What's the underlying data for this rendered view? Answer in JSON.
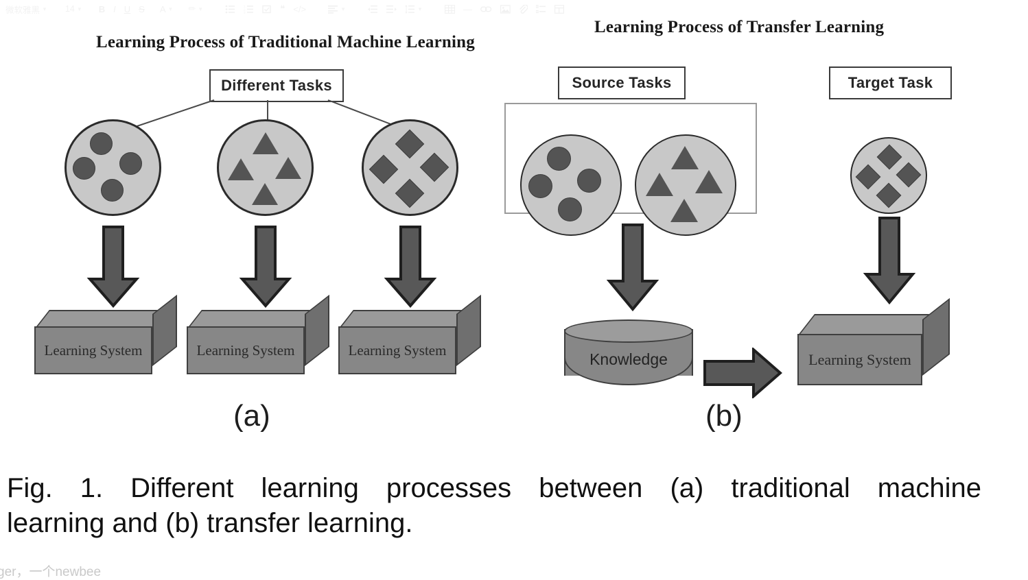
{
  "toolbar": {
    "font_family": "微软雅黑",
    "font_size": "14",
    "items": [
      {
        "name": "font-family-select",
        "label": "微软雅黑"
      },
      {
        "name": "font-size-select",
        "label": "14"
      },
      {
        "name": "bold-button",
        "label": "B"
      },
      {
        "name": "italic-button",
        "label": "I"
      },
      {
        "name": "underline-button",
        "label": "U"
      },
      {
        "name": "strikethrough-button",
        "label": "S"
      },
      {
        "name": "font-color-button",
        "label": "A"
      },
      {
        "name": "highlight-color-button",
        "label": "✏"
      },
      {
        "name": "bulleted-list-button",
        "label": "≔"
      },
      {
        "name": "numbered-list-button",
        "label": "≡"
      },
      {
        "name": "checklist-button",
        "label": "☑"
      },
      {
        "name": "blockquote-button",
        "label": "❝"
      },
      {
        "name": "code-block-button",
        "label": "</>"
      },
      {
        "name": "align-button",
        "label": "≣"
      },
      {
        "name": "outdent-button",
        "label": "⇤"
      },
      {
        "name": "indent-button",
        "label": "⇥"
      },
      {
        "name": "line-height-button",
        "label": "↕"
      },
      {
        "name": "table-button",
        "label": "▦"
      },
      {
        "name": "horizontal-rule-button",
        "label": "—"
      },
      {
        "name": "link-button",
        "label": "🔗"
      },
      {
        "name": "image-button",
        "label": "🖼"
      },
      {
        "name": "attachment-button",
        "label": "📎"
      },
      {
        "name": "task-list-button",
        "label": "☰"
      },
      {
        "name": "layout-button",
        "label": "▤"
      }
    ]
  },
  "figure": {
    "caption_line1": "Fig. 1. Different learning processes between (a) traditional machine",
    "caption_line2": "learning and (b) transfer learning.",
    "watermark": "ger，一个newbee",
    "panel_a": {
      "id": "(a)",
      "title": "Learning Process of Traditional Machine Learning",
      "source_box_label": "Different Tasks",
      "tasks": [
        {
          "shape": "circle",
          "count": 4,
          "system_label": "Learning System"
        },
        {
          "shape": "triangle",
          "count": 4,
          "system_label": "Learning System"
        },
        {
          "shape": "diamond",
          "count": 4,
          "system_label": "Learning System"
        }
      ]
    },
    "panel_b": {
      "id": "(b)",
      "title": "Learning Process of Transfer Learning",
      "source_box_label": "Source Tasks",
      "target_box_label": "Target Task",
      "source_tasks": [
        {
          "shape": "circle",
          "count": 4
        },
        {
          "shape": "triangle",
          "count": 4
        }
      ],
      "target_task": {
        "shape": "diamond",
        "count": 4
      },
      "knowledge_label": "Knowledge",
      "learning_system_label": "Learning System"
    }
  },
  "colors": {
    "page_background": "#ffffff",
    "circle_fill": "#c8c8c8",
    "circle_stroke": "#2b2b2b",
    "shape_fill": "#545454",
    "box_fill": "#878787",
    "box_top_fill": "#9a9a9a",
    "box_side_fill": "#6f6f6f",
    "arrow_fill": "#585858",
    "arrow_stroke": "#1f1f1f",
    "task_box_stroke": "#3a3a3a",
    "group_box_stroke": "#9a9a9a",
    "text": "#111111",
    "watermark": "#c9c9c9"
  }
}
